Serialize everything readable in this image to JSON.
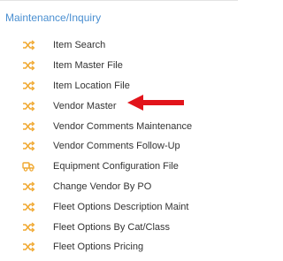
{
  "section": {
    "title": "Maintenance/Inquiry"
  },
  "menu": {
    "items": [
      {
        "label": "Item Search",
        "icon": "shuffle-icon"
      },
      {
        "label": "Item Master File",
        "icon": "shuffle-icon"
      },
      {
        "label": "Item Location File",
        "icon": "shuffle-icon"
      },
      {
        "label": "Vendor Master",
        "icon": "shuffle-icon"
      },
      {
        "label": "Vendor Comments Maintenance",
        "icon": "shuffle-icon"
      },
      {
        "label": "Vendor Comments Follow-Up",
        "icon": "shuffle-icon"
      },
      {
        "label": "Equipment Configuration File",
        "icon": "truck-icon"
      },
      {
        "label": "Change Vendor By PO",
        "icon": "shuffle-icon"
      },
      {
        "label": "Fleet Options Description Maint",
        "icon": "shuffle-icon"
      },
      {
        "label": "Fleet Options By Cat/Class",
        "icon": "shuffle-icon"
      },
      {
        "label": "Fleet Options Pricing",
        "icon": "shuffle-icon"
      }
    ]
  },
  "colors": {
    "title": "#4a8fd1",
    "icon": "#f0a830",
    "text": "#333333",
    "arrow": "#e2141b"
  },
  "annotation": {
    "icon": "red-arrow-icon",
    "points_to": "Vendor Master"
  }
}
